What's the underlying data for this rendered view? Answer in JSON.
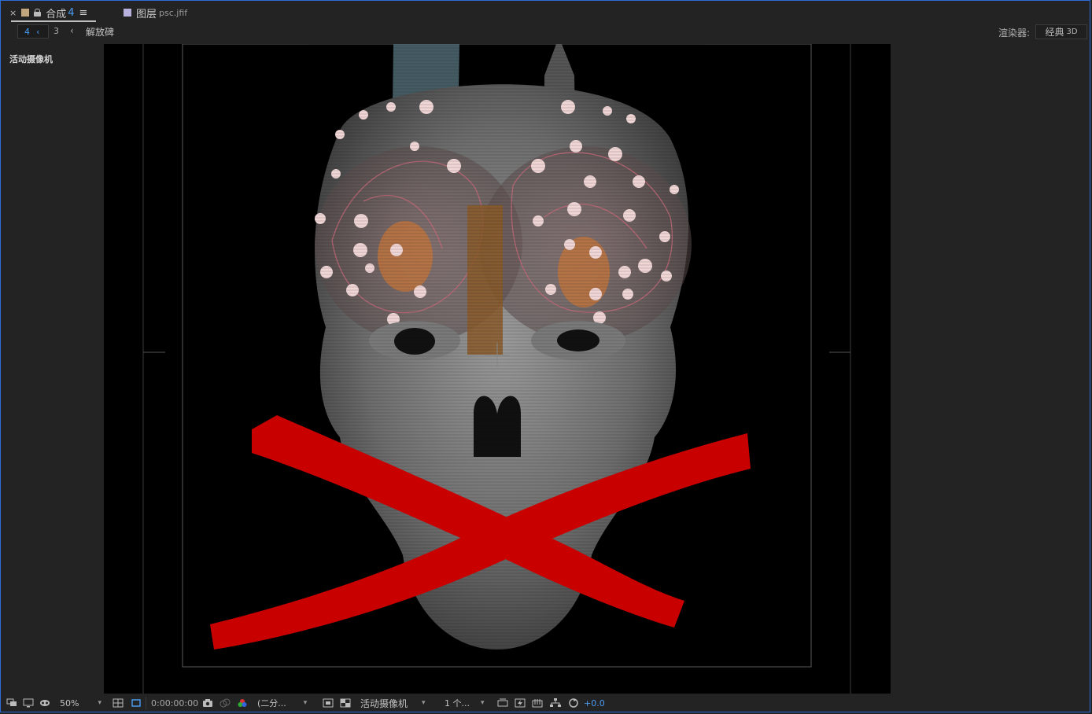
{
  "tabs": [
    {
      "close": "×",
      "title": "合成",
      "number": "4",
      "menu": "≡"
    },
    {
      "title": "图层",
      "subtitle": "psc.jfif"
    }
  ],
  "breadcrumb": {
    "active": "4",
    "previous": "3",
    "arrow": "‹",
    "label": "解放碑"
  },
  "renderer": {
    "label": "渲染器:",
    "value": "经典",
    "value_suffix": "3D"
  },
  "viewer": {
    "camera_label": "活动摄像机"
  },
  "toolbar": {
    "zoom": "50%",
    "timecode": "0:00:00:00",
    "resolution": "(二分...",
    "camera": "活动摄像机",
    "views": "1 个...",
    "exposure": "+0.0"
  },
  "colors": {
    "accent": "#4a9df5",
    "frame": "#2d6cd6",
    "background": "#232323",
    "cross": "#c80000"
  }
}
